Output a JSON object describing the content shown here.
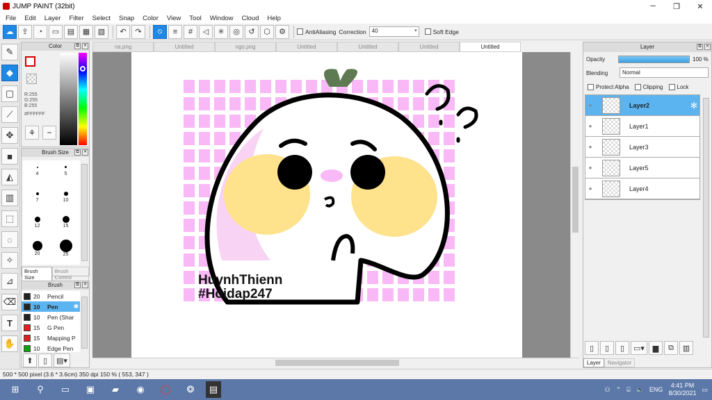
{
  "window": {
    "title": "JUMP PAINT (32bit)"
  },
  "menu": [
    "File",
    "Edit",
    "Layer",
    "Filter",
    "Select",
    "Snap",
    "Color",
    "View",
    "Tool",
    "Window",
    "Cloud",
    "Help"
  ],
  "toolbar": {
    "antialiasing": "AntiAliasing",
    "correction_label": "Correction",
    "correction_value": "40",
    "soft_edge": "Soft Edge"
  },
  "tabs": [
    "na.png",
    "Untitled",
    "ngo.png",
    "Untitled",
    "Untitled",
    "Untitled",
    "Untitled"
  ],
  "color_panel": {
    "title": "Color",
    "r": "R:255",
    "g": "G:255",
    "b": "B:255",
    "hex": "#FFFFFF"
  },
  "brush_size": {
    "title": "Brush Size",
    "sizes": [
      "4",
      "5",
      "7",
      "10",
      "12",
      "15",
      "20",
      "25"
    ],
    "tab1": "Brush Size",
    "tab2": "Brush Control"
  },
  "brush": {
    "title": "Brush",
    "items": [
      {
        "size": "20",
        "name": "Pencil",
        "color": "#222222"
      },
      {
        "size": "10",
        "name": "Pen",
        "color": "#222222"
      },
      {
        "size": "10",
        "name": "Pen (Shar",
        "color": "#222222"
      },
      {
        "size": "15",
        "name": "G Pen",
        "color": "#e02020"
      },
      {
        "size": "15",
        "name": "Mapping P",
        "color": "#e02020"
      },
      {
        "size": "10",
        "name": "Edge Pen",
        "color": "#10a010"
      }
    ]
  },
  "layer_panel": {
    "title": "Layer",
    "opacity_label": "Opacity",
    "opacity_value": "100 %",
    "opacity_fraction": 1.0,
    "blending_label": "Blending",
    "blending_value": "Normal",
    "protect_alpha": "Protect Alpha",
    "clipping": "Clipping",
    "lock": "Lock",
    "layers": [
      "Layer2",
      "Layer1",
      "Layer3",
      "Layer5",
      "Layer4"
    ],
    "tab_layer": "Layer",
    "tab_navigator": "Navigator"
  },
  "artwork": {
    "line1": "HuynhThienn",
    "line2": "#Hoidap247"
  },
  "status": {
    "text": "500 * 500 pixel  (3.6 * 3.6cm)  350 dpi  150 %  ( 553, 347 )"
  },
  "taskbar": {
    "lang": "ENG",
    "time": "4:41 PM",
    "date": "8/30/2021"
  },
  "colors": {
    "accent": "#1e88e5",
    "pink": "#f9b8f6",
    "yellow": "#ffe28c",
    "leaf": "#5d7a52",
    "taskbar": "#5b78a8"
  }
}
